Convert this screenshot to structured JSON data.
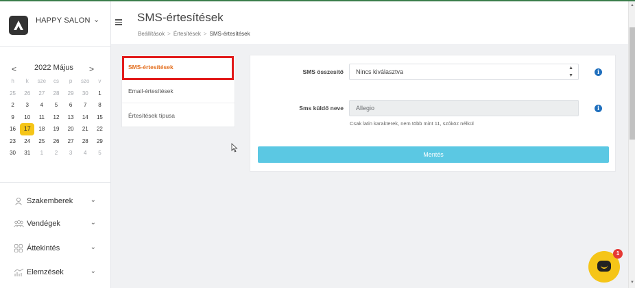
{
  "brand": {
    "name": "HAPPY SALON",
    "chevron_icon": "chevron-down-icon"
  },
  "calendar": {
    "title": "2022 Május",
    "prev": "<",
    "next": ">",
    "weekdays": [
      "h",
      "k",
      "sze",
      "cs",
      "p",
      "szo",
      "v"
    ],
    "weeks": [
      [
        "25",
        "26",
        "27",
        "28",
        "29",
        "30",
        "1"
      ],
      [
        "2",
        "3",
        "4",
        "5",
        "6",
        "7",
        "8"
      ],
      [
        "9",
        "10",
        "11",
        "12",
        "13",
        "14",
        "15"
      ],
      [
        "16",
        "17",
        "18",
        "19",
        "20",
        "21",
        "22"
      ],
      [
        "23",
        "24",
        "25",
        "26",
        "27",
        "28",
        "29"
      ],
      [
        "30",
        "31",
        "1",
        "2",
        "3",
        "4",
        "5"
      ]
    ],
    "today": "17"
  },
  "nav": {
    "items": [
      {
        "label": "Szakemberek",
        "icon": "person-icon"
      },
      {
        "label": "Vendégek",
        "icon": "group-icon"
      },
      {
        "label": "Áttekintés",
        "icon": "grid-icon"
      },
      {
        "label": "Elemzések",
        "icon": "chart-icon"
      }
    ]
  },
  "header": {
    "title": "SMS-értesítések",
    "breadcrumb": [
      "Beállítások",
      "Értesítések",
      "SMS-értesítések"
    ],
    "breadcrumb_separator": ">"
  },
  "submenu": {
    "items": [
      {
        "label": "SMS-értesítések",
        "active": true
      },
      {
        "label": "Email-értesítések",
        "active": false
      },
      {
        "label": "Értesítések típusa",
        "active": false
      }
    ]
  },
  "form": {
    "sms_summary_label": "SMS összesítő",
    "sms_summary_value": "Nincs kiválasztva",
    "sender_label": "Sms küldő neve",
    "sender_value": "Allegio",
    "sender_hint": "Csak latin karakterek, nem több mint 11, szóköz nélkül",
    "info_glyph": "i",
    "save_label": "Mentés"
  },
  "chat": {
    "badge": "1"
  },
  "colors": {
    "accent_orange": "#e36d1c",
    "highlight_red": "#e21b1b",
    "save_button": "#5bc8e3",
    "today_yellow": "#f5c518",
    "info_blue": "#1f6fbd"
  }
}
